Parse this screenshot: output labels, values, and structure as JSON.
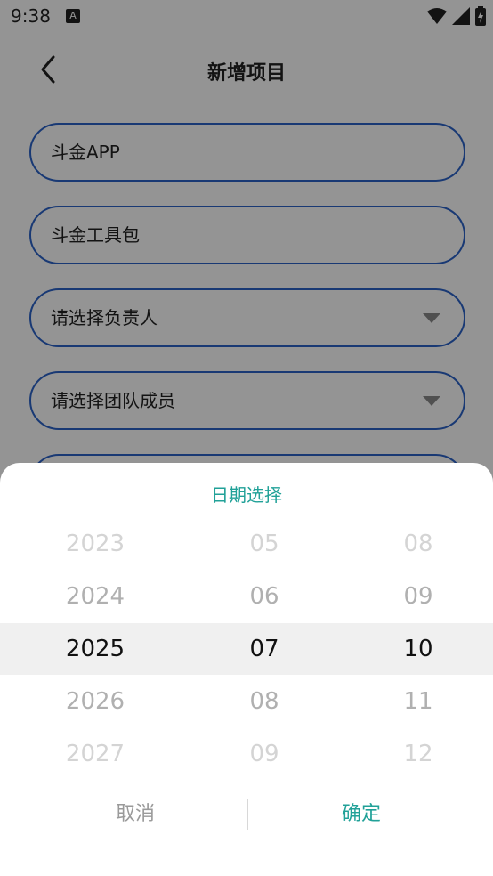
{
  "status": {
    "time": "9:38",
    "a_label": "A"
  },
  "header": {
    "title": "新增项目"
  },
  "form": {
    "fields": [
      {
        "text": "斗金APP"
      },
      {
        "text": "斗金工具包"
      },
      {
        "text": "请选择负责人"
      },
      {
        "text": "请选择团队成员"
      }
    ]
  },
  "picker": {
    "title": "日期选择",
    "years": [
      "2023",
      "2024",
      "2025",
      "2026",
      "2027"
    ],
    "months": [
      "05",
      "06",
      "07",
      "08",
      "09"
    ],
    "days": [
      "08",
      "09",
      "10",
      "11",
      "12"
    ],
    "cancel_label": "取消",
    "confirm_label": "确定"
  },
  "colors": {
    "accent": "#21a198",
    "field_border": "#2b63c8"
  }
}
